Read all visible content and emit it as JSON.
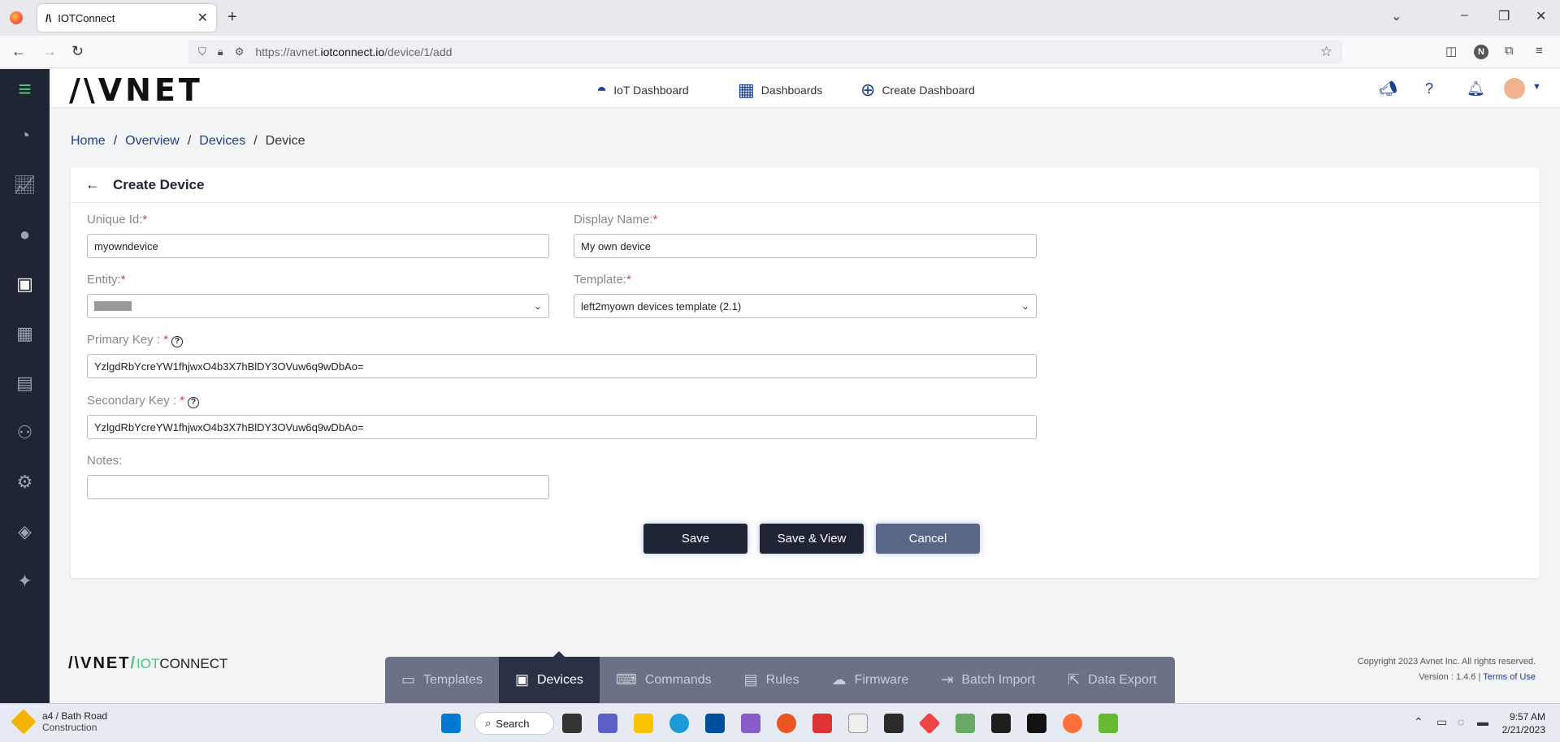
{
  "browser": {
    "tab_title": "IOTConnect",
    "url_prefix": "https://avnet.",
    "url_host": "iotconnect.io",
    "url_path": "/device/1/add",
    "profile_initial": "N"
  },
  "header": {
    "logo": "/\\VNET",
    "nav": [
      {
        "label": "IoT Dashboard",
        "icon": "gauge-icon"
      },
      {
        "label": "Dashboards",
        "icon": "grid-icon"
      },
      {
        "label": "Create Dashboard",
        "icon": "plus-circle-icon"
      }
    ]
  },
  "breadcrumb": [
    "Home",
    "Overview",
    "Devices",
    "Device"
  ],
  "form": {
    "title": "Create Device",
    "unique_id_label": "Unique Id:",
    "unique_id_value": "myowndevice",
    "display_name_label": "Display Name:",
    "display_name_value": "My own device",
    "entity_label": "Entity:",
    "entity_value": "",
    "template_label": "Template:",
    "template_value": "left2myown devices template (2.1)",
    "primary_key_label": "Primary Key : ",
    "primary_key_value": "YzlgdRbYcreYW1fhjwxO4b3X7hBlDY3OVuw6q9wDbAo=",
    "secondary_key_label": "Secondary Key : ",
    "secondary_key_value": "YzlgdRbYcreYW1fhjwxO4b3X7hBlDY3OVuw6q9wDbAo=",
    "notes_label": "Notes:",
    "notes_value": "",
    "required_mark": "*",
    "save": "Save",
    "save_view": "Save & View",
    "cancel": "Cancel"
  },
  "footer": {
    "logo_main": "/\\VNET",
    "logo_slash": "/",
    "logo_iot_a": "IOT",
    "logo_iot_b": "CONNECT",
    "copyright": "Copyright 2023 Avnet Inc. All rights reserved.",
    "version": "Version : 1.4.6 | ",
    "terms": "Terms of Use"
  },
  "bottom_nav": [
    {
      "label": "Templates",
      "icon": "template-icon",
      "active": false
    },
    {
      "label": "Devices",
      "icon": "chip-icon",
      "active": true
    },
    {
      "label": "Commands",
      "icon": "code-icon",
      "active": false
    },
    {
      "label": "Rules",
      "icon": "rules-icon",
      "active": false
    },
    {
      "label": "Firmware",
      "icon": "cloud-icon",
      "active": false
    },
    {
      "label": "Batch Import",
      "icon": "import-icon",
      "active": false
    },
    {
      "label": "Data Export",
      "icon": "export-icon",
      "active": false
    }
  ],
  "taskbar": {
    "weather_title": "a4 / Bath Road",
    "weather_sub": "Construction",
    "search": "Search",
    "time": "9:57 AM",
    "date": "2/21/2023"
  }
}
